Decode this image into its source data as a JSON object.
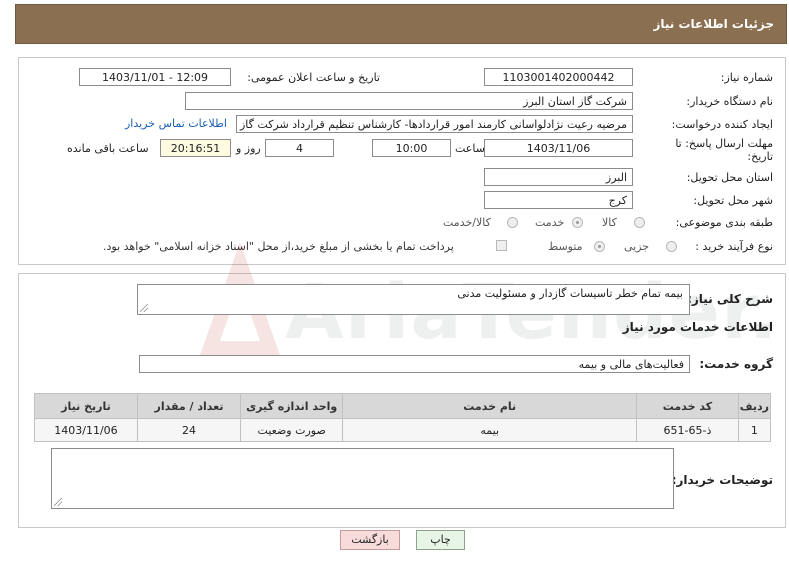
{
  "header": {
    "title": "جزئیات اطلاعات نیاز"
  },
  "form": {
    "need_number_label": "شماره نیاز:",
    "need_number": "1103001402000442",
    "announce_label": "تاریخ و ساعت اعلان عمومی:",
    "announce_value": "1403/11/01 - 12:09",
    "buyer_org_label": "نام دستگاه خریدار:",
    "buyer_org": "شرکت گاز استان البرز",
    "creator_label": "ایجاد کننده درخواست:",
    "creator": "مرضیه رعیت نژادلواسانی کارمند امور قراردادها- کارشناس تنظیم قرارداد شرکت گاز استان البرز",
    "contact_link": "اطلاعات تماس خریدار",
    "deadline_label_1": "مهلت ارسال پاسخ: تا",
    "deadline_label_2": "تاریخ:",
    "deadline_date": "1403/11/06",
    "time_label": "ساعت",
    "deadline_time": "10:00",
    "days_value": "4",
    "days_label": "روز و",
    "remaining_time": "20:16:51",
    "remaining_label": "ساعت باقی مانده",
    "province_label": "استان محل تحویل:",
    "province": "البرز",
    "city_label": "شهر محل تحویل:",
    "city": "کرج",
    "category_label": "طبقه بندی موضوعی:",
    "category_options": [
      "کالا",
      "خدمت",
      "کالا/خدمت"
    ],
    "category_selected": "خدمت",
    "purchase_type_label": "نوع فرآیند خرید :",
    "purchase_options": [
      "جزیی",
      "متوسط"
    ],
    "purchase_selected": "متوسط",
    "payment_note": "پرداخت تمام یا بخشی از مبلغ خرید،از محل \"اسناد خزانه اسلامی\" خواهد بود."
  },
  "details": {
    "summary_label": "شرح کلی نیاز:",
    "summary": "بیمه تمام خطر تاسیسات گازدار و مسئولیت مدنی",
    "services_info_label": "اطلاعات خدمات مورد نیاز",
    "service_group_label": "گروه خدمت:",
    "service_group": "فعالیت‌های مالی و بیمه",
    "table": {
      "headers": [
        "ردیف",
        "کد خدمت",
        "نام خدمت",
        "واحد اندازه گیری",
        "تعداد / مقدار",
        "تاریخ نیاز"
      ],
      "rows": [
        [
          "1",
          "ذ-65-651",
          "بیمه",
          "صورت وضعیت",
          "24",
          "1403/11/06"
        ]
      ]
    },
    "buyer_notes_label": "توضیحات خریدار:",
    "buyer_notes": ""
  },
  "buttons": {
    "print": "چاپ",
    "back": "بازگشت"
  },
  "watermark": {
    "text": "AriaTender.net"
  },
  "colors": {
    "header_bg": "#8a7051",
    "back_button_bg": "#f8dcdc",
    "print_button_bg": "#e6f5e6",
    "link": "#1a5fb4"
  }
}
